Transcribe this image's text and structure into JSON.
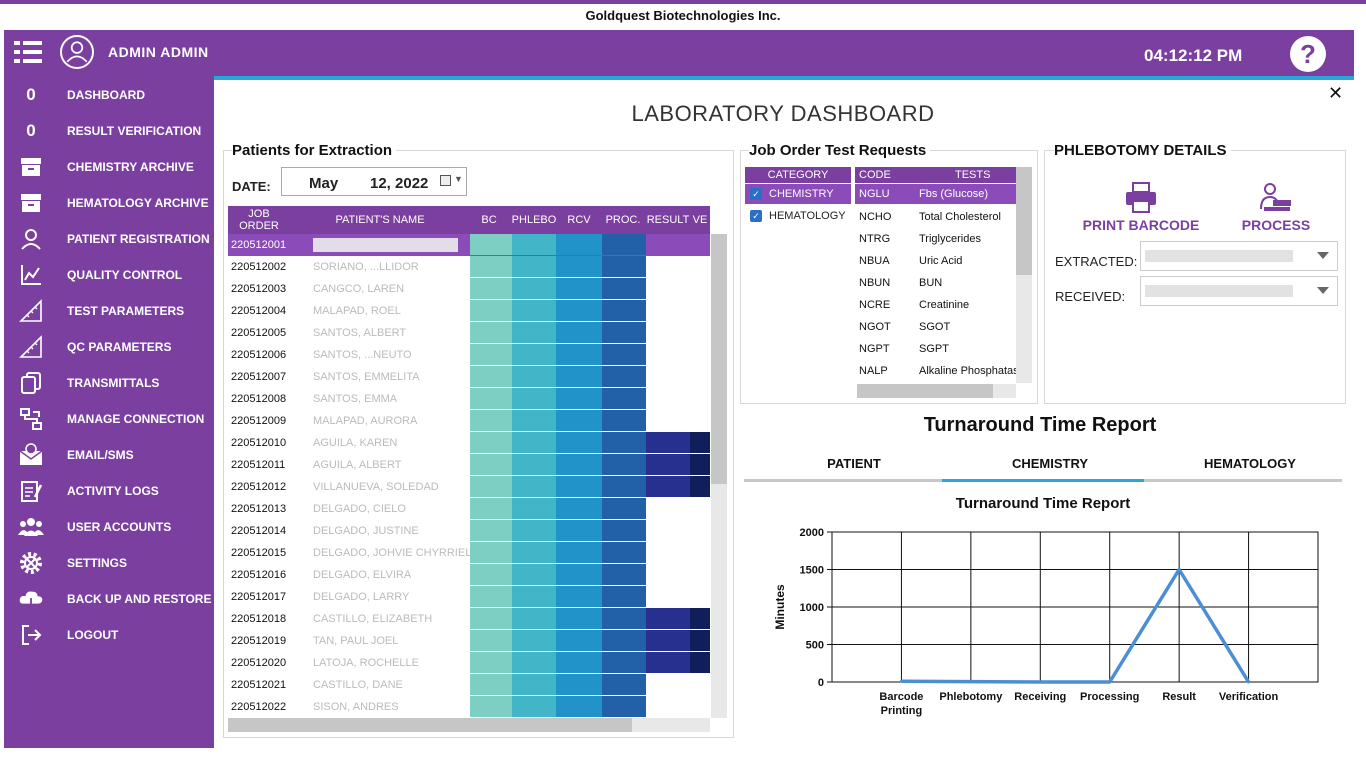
{
  "company": "Goldquest Biotechnologies Inc.",
  "header": {
    "user": "ADMIN  ADMIN",
    "clock": "04:12:12 PM",
    "help": "?"
  },
  "colors": {
    "brand": "#7b3fa0",
    "accent": "#2aa7d8",
    "bc": "#7dcfc3",
    "phlebo": "#42b5c8",
    "rcv": "#2293c9",
    "proc": "#2260a8",
    "result": "#272f8f",
    "ver": "#101f5c"
  },
  "sidebar": {
    "items": [
      {
        "label": "DASHBOARD",
        "icon": "counter-zero",
        "glyph": "0"
      },
      {
        "label": "RESULT VERIFICATION",
        "icon": "counter-zero",
        "glyph": "0"
      },
      {
        "label": "CHEMISTRY ARCHIVE",
        "icon": "archive-icon",
        "glyph": ""
      },
      {
        "label": "HEMATOLOGY ARCHIVE",
        "icon": "archive-icon",
        "glyph": ""
      },
      {
        "label": "PATIENT REGISTRATION",
        "icon": "user-badge-icon",
        "glyph": ""
      },
      {
        "label": "QUALITY CONTROL",
        "icon": "line-chart-icon",
        "glyph": ""
      },
      {
        "label": "TEST PARAMETERS",
        "icon": "ruler-icon",
        "glyph": ""
      },
      {
        "label": "QC PARAMETERS",
        "icon": "ruler-icon",
        "glyph": ""
      },
      {
        "label": "TRANSMITTALS",
        "icon": "copy-icon",
        "glyph": ""
      },
      {
        "label": "MANAGE CONNECTION",
        "icon": "network-icon",
        "glyph": ""
      },
      {
        "label": "EMAIL/SMS",
        "icon": "mail-icon",
        "glyph": ""
      },
      {
        "label": "ACTIVITY LOGS",
        "icon": "notepad-icon",
        "glyph": ""
      },
      {
        "label": "USER ACCOUNTS",
        "icon": "users-icon",
        "glyph": ""
      },
      {
        "label": "SETTINGS",
        "icon": "gear-icon",
        "glyph": ""
      },
      {
        "label": "BACK UP AND RESTORE",
        "icon": "cloud-icon",
        "glyph": ""
      },
      {
        "label": "LOGOUT",
        "icon": "logout-icon",
        "glyph": ""
      }
    ]
  },
  "main": {
    "title": "LABORATORY DASHBOARD",
    "close": "✕"
  },
  "patients": {
    "title": "Patients for Extraction",
    "date_label": "DATE:",
    "date_month": "May",
    "date_day": "12, 2022",
    "columns": [
      "JOB ORDER",
      "PATIENT'S NAME",
      "BC",
      "PHLEBO",
      "RCV",
      "PROC.",
      "RESULT",
      "VE"
    ],
    "rows": [
      {
        "job": "220512001",
        "name": "",
        "stages": 4
      },
      {
        "job": "220512002",
        "name": "SORIANO, ...LLIDOR",
        "stages": 4
      },
      {
        "job": "220512003",
        "name": "CANGCO, LAREN",
        "stages": 4
      },
      {
        "job": "220512004",
        "name": "MALAPAD, ROEL",
        "stages": 4
      },
      {
        "job": "220512005",
        "name": "SANTOS, ALBERT",
        "stages": 4
      },
      {
        "job": "220512006",
        "name": "SANTOS, ...NEUTO",
        "stages": 4
      },
      {
        "job": "220512007",
        "name": "SANTOS, EMMELITA",
        "stages": 4
      },
      {
        "job": "220512008",
        "name": "SANTOS, EMMA",
        "stages": 4
      },
      {
        "job": "220512009",
        "name": "MALAPAD, AURORA",
        "stages": 4
      },
      {
        "job": "220512010",
        "name": "AGUILA, KAREN",
        "stages": 6
      },
      {
        "job": "220512011",
        "name": "AGUILA, ALBERT",
        "stages": 6
      },
      {
        "job": "220512012",
        "name": "VILLANUEVA, SOLEDAD",
        "stages": 6
      },
      {
        "job": "220512013",
        "name": "DELGADO, CIELO",
        "stages": 4
      },
      {
        "job": "220512014",
        "name": "DELGADO, JUSTINE",
        "stages": 4
      },
      {
        "job": "220512015",
        "name": "DELGADO, JOHVIE CHYRRIEL",
        "stages": 4
      },
      {
        "job": "220512016",
        "name": "DELGADO, ELVIRA",
        "stages": 4
      },
      {
        "job": "220512017",
        "name": "DELGADO, LARRY",
        "stages": 4
      },
      {
        "job": "220512018",
        "name": "CASTILLO, ELIZABETH",
        "stages": 6
      },
      {
        "job": "220512019",
        "name": "TAN, PAUL JOEL",
        "stages": 6
      },
      {
        "job": "220512020",
        "name": "LATOJA, ROCHELLE",
        "stages": 6
      },
      {
        "job": "220512021",
        "name": "CASTILLO, DANE",
        "stages": 4
      },
      {
        "job": "220512022",
        "name": "SISON, ANDRES",
        "stages": 4
      }
    ]
  },
  "job_order": {
    "title": "Job Order Test Requests",
    "category_header": "CATEGORY",
    "categories": [
      {
        "label": "CHEMISTRY",
        "checked": true,
        "selected": true
      },
      {
        "label": "HEMATOLOGY",
        "checked": true,
        "selected": false
      }
    ],
    "code_header": "CODE",
    "tests_header": "TESTS",
    "tests": [
      {
        "code": "NGLU",
        "name": "Fbs (Glucose)"
      },
      {
        "code": "NCHO",
        "name": "Total Cholesterol"
      },
      {
        "code": "NTRG",
        "name": "Triglycerides"
      },
      {
        "code": "NBUA",
        "name": "Uric Acid"
      },
      {
        "code": "NBUN",
        "name": "BUN"
      },
      {
        "code": "NCRE",
        "name": "Creatinine"
      },
      {
        "code": "NGOT",
        "name": "SGOT"
      },
      {
        "code": "NGPT",
        "name": "SGPT"
      },
      {
        "code": "NALP",
        "name": "Alkaline Phosphatase"
      }
    ]
  },
  "phlebotomy": {
    "title": "PHLEBOTOMY DETAILS",
    "print_barcode": "PRINT BARCODE",
    "process": "PROCESS",
    "extracted_label": "EXTRACTED:",
    "received_label": "RECEIVED:"
  },
  "tat": {
    "title": "Turnaround Time Report",
    "tabs": [
      "PATIENT",
      "CHEMISTRY",
      "HEMATOLOGY"
    ],
    "active_tab": 1
  },
  "chart_data": {
    "type": "line",
    "title": "Turnaround Time Report",
    "xlabel": "",
    "ylabel": "Minutes",
    "categories": [
      "Barcode Printing",
      "Phlebotomy",
      "Receiving",
      "Processing",
      "Result",
      "Verification"
    ],
    "series": [
      {
        "values": [
          10,
          5,
          0,
          0,
          1500,
          0
        ]
      }
    ],
    "ylim": [
      0,
      2000
    ],
    "yticks": [
      0,
      500,
      1000,
      1500,
      2000
    ],
    "grid": true,
    "color": "#4a8fd6"
  }
}
